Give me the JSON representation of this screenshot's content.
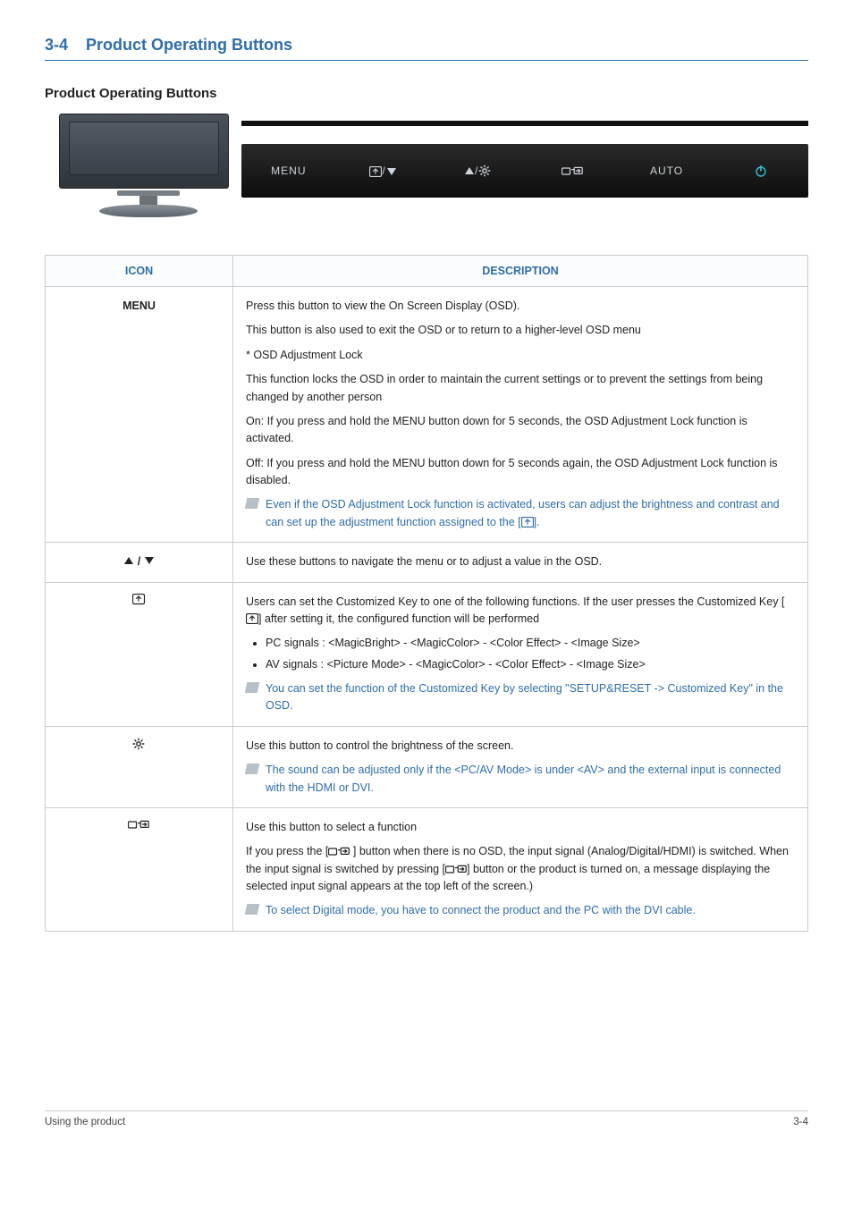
{
  "section": {
    "num": "3-4",
    "title": "Product Operating Buttons"
  },
  "subtitle": "Product Operating Buttons",
  "buttons_bar": {
    "b1": "MENU",
    "b5": "AUTO"
  },
  "table": {
    "head": {
      "c1": "ICON",
      "c2": "DESCRIPTION"
    },
    "row_menu": {
      "icon": "MENU",
      "p1": "Press this button to view the On Screen Display (OSD).",
      "p2": "This button is also used to exit the OSD or to return to a higher-level OSD menu",
      "p3": "* OSD Adjustment Lock",
      "p4": "This function locks the OSD in order to maintain the current settings or to prevent the settings from being changed by another person",
      "p5": "On: If you press and hold the MENU button down for 5 seconds, the OSD Adjustment Lock function is activated.",
      "p6": "Off: If you press and hold the MENU button down for 5 seconds again, the OSD Adjustment Lock function is disabled.",
      "note_a": "Even if the OSD Adjustment Lock function is activated, users can adjust the brightness and contrast and can set up the adjustment function assigned to the [",
      "note_b": "]."
    },
    "row_nav": {
      "p1": "Use these buttons to navigate the menu or to adjust a value in the OSD."
    },
    "row_custom": {
      "p1a": "Users can set the Customized Key to one of the following functions. If the user presses the Customized Key [",
      "p1b": "] after setting it, the configured function will be performed",
      "li1": "PC signals : <MagicBright> - <MagicColor> - <Color Effect> - <Image Size>",
      "li2": "AV signals : <Picture Mode> - <MagicColor> - <Color Effect> - <Image Size>",
      "note": "You can set the function of the Customized Key by selecting \"SETUP&RESET -> Customized Key\" in the OSD."
    },
    "row_bright": {
      "p1": "Use this button to control the brightness of the screen.",
      "note": "The sound can be adjusted only if the <PC/AV Mode> is under <AV> and the external input is connected with the HDMI or DVI."
    },
    "row_source": {
      "p1": "Use this button to select a function",
      "p2a": "If you press the [",
      "p2b": " ] button when there is no OSD, the input signal (Analog/Digital/HDMI) is switched. When the input signal is switched by pressing [",
      "p2c": "] button or the product is turned on, a message displaying the selected input signal appears at the top left of the screen.)",
      "note": "To select Digital mode, you have to connect the product and the PC with the DVI cable."
    }
  },
  "footer": {
    "left": "Using the product",
    "right": "3-4"
  }
}
